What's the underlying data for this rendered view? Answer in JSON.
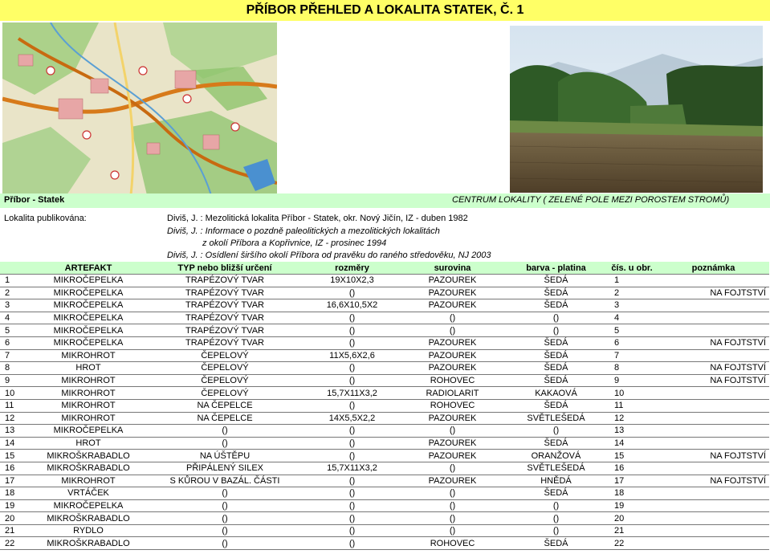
{
  "title": "PŘÍBOR PŘEHLED A LOKALITA STATEK, Č. 1",
  "caption_left": "Příbor - Statek",
  "caption_right": "CENTRUM LOKALITY ( ZELENÉ POLE MEZI POROSTEM STROMŮ)",
  "published_label": "Lokalita publikována:",
  "publications": [
    "Diviš, J. : Mezolitická lokalita Příbor - Statek, okr. Nový Jičín, IZ - duben 1982",
    "Diviš, J. : Informace o pozdně paleolitických a mezolitických lokalitách",
    "z okolí Příbora a Kopřivnice, IZ - prosinec 1994",
    "Diviš, J. : Osídlení širšího okolí Příbora od pravěku do raného středověku, NJ 2003"
  ],
  "table": {
    "headers": [
      "",
      "ARTEFAKT",
      "TYP nebo bližší určení",
      "rozměry",
      "surovina",
      "barva - platina",
      "čís. u obr.",
      "poznámka"
    ],
    "rows": [
      [
        "1",
        "MIKROČEPELKA",
        "TRAPÉZOVÝ TVAR",
        "19X10X2,3",
        "PAZOUREK",
        "ŠEDÁ",
        "1",
        ""
      ],
      [
        "2",
        "MIKROČEPELKA",
        "TRAPÉZOVÝ TVAR",
        "()",
        "PAZOUREK",
        "ŠEDÁ",
        "2",
        "NA FOJTSTVÍ"
      ],
      [
        "3",
        "MIKROČEPELKA",
        "TRAPÉZOVÝ TVAR",
        "16,6X10,5X2",
        "PAZOUREK",
        "ŠEDÁ",
        "3",
        ""
      ],
      [
        "4",
        "MIKROČEPELKA",
        "TRAPÉZOVÝ TVAR",
        "()",
        "()",
        "()",
        "4",
        ""
      ],
      [
        "5",
        "MIKROČEPELKA",
        "TRAPÉZOVÝ TVAR",
        "()",
        "()",
        "()",
        "5",
        ""
      ],
      [
        "6",
        "MIKROČEPELKA",
        "TRAPÉZOVÝ TVAR",
        "()",
        "PAZOUREK",
        "ŠEDÁ",
        "6",
        "NA FOJTSTVÍ"
      ],
      [
        "7",
        "MIKROHROT",
        "ČEPELOVÝ",
        "11X5,6X2,6",
        "PAZOUREK",
        "ŠEDÁ",
        "7",
        ""
      ],
      [
        "8",
        "HROT",
        "ČEPELOVÝ",
        "()",
        "PAZOUREK",
        "ŠEDÁ",
        "8",
        "NA FOJTSTVÍ"
      ],
      [
        "9",
        "MIKROHROT",
        "ČEPELOVÝ",
        "()",
        "ROHOVEC",
        "ŠEDÁ",
        "9",
        "NA FOJTSTVÍ"
      ],
      [
        "10",
        "MIKROHROT",
        "ČEPELOVÝ",
        "15,7X11X3,2",
        "RADIOLARIT",
        "KAKAOVÁ",
        "10",
        ""
      ],
      [
        "11",
        "MIKROHROT",
        "NA ČEPELCE",
        "()",
        "ROHOVEC",
        "ŠEDÁ",
        "11",
        ""
      ],
      [
        "12",
        "MIKROHROT",
        "NA ČEPELCE",
        "14X5,5X2,2",
        "PAZOUREK",
        "SVĚTLEŠEDÁ",
        "12",
        ""
      ],
      [
        "13",
        "MIKROČEPELKA",
        "()",
        "()",
        "()",
        "()",
        "13",
        ""
      ],
      [
        "14",
        "HROT",
        "()",
        "()",
        "PAZOUREK",
        "ŠEDÁ",
        "14",
        ""
      ],
      [
        "15",
        "MIKROŠKRABADLO",
        "NA ÚŠTĚPU",
        "()",
        "PAZOUREK",
        "ORANŽOVÁ",
        "15",
        "NA FOJTSTVÍ"
      ],
      [
        "16",
        "MIKROŠKRABADLO",
        "PŘIPÁLENÝ SILEX",
        "15,7X11X3,2",
        "()",
        "SVĚTLEŠEDÁ",
        "16",
        ""
      ],
      [
        "17",
        "MIKROHROT",
        "S KŮROU V BAZÁL. ČÁSTI",
        "()",
        "PAZOUREK",
        "HNĚDÁ",
        "17",
        "NA FOJTSTVÍ"
      ],
      [
        "18",
        "VRTÁČEK",
        "()",
        "()",
        "()",
        "ŠEDÁ",
        "18",
        ""
      ],
      [
        "19",
        "MIKROČEPELKA",
        "()",
        "()",
        "()",
        "()",
        "19",
        ""
      ],
      [
        "20",
        "MIKROŠKRABADLO",
        "()",
        "()",
        "()",
        "()",
        "20",
        ""
      ],
      [
        "21",
        "RYDLO",
        "()",
        "()",
        "()",
        "()",
        "21",
        ""
      ],
      [
        "22",
        "MIKROŠKRABADLO",
        "()",
        "()",
        "ROHOVEC",
        "ŠEDÁ",
        "22",
        ""
      ]
    ]
  },
  "colors": {
    "title_bg": "#ffff66",
    "header_bg": "#ccffcc"
  }
}
